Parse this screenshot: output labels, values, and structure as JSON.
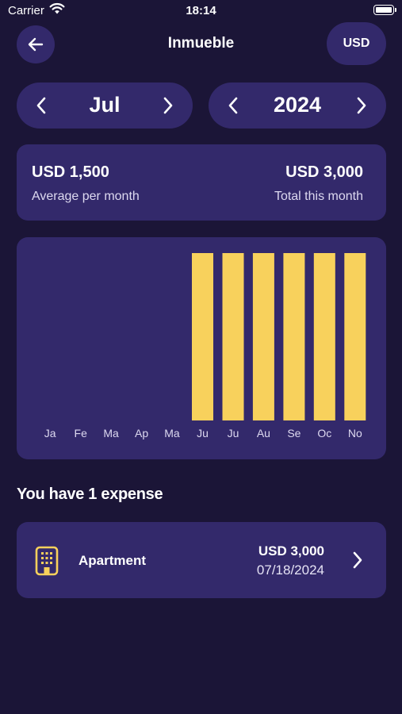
{
  "status_bar": {
    "carrier": "Carrier",
    "time": "18:14"
  },
  "header": {
    "title": "Inmueble",
    "currency": "USD"
  },
  "selectors": {
    "month": "Jul",
    "year": "2024"
  },
  "summary": {
    "average_amount": "USD 1,500",
    "average_label": "Average per month",
    "total_amount": "USD 3,000",
    "total_label": "Total this month"
  },
  "chart_data": {
    "type": "bar",
    "categories": [
      "Ja",
      "Fe",
      "Ma",
      "Ap",
      "Ma",
      "Ju",
      "Ju",
      "Au",
      "Se",
      "Oc",
      "No"
    ],
    "values": [
      0,
      0,
      0,
      0,
      0,
      3000,
      3000,
      3000,
      3000,
      3000,
      3000
    ],
    "ylim": [
      0,
      3000
    ],
    "grid": false,
    "colors": {
      "bar": "#f8d15c"
    }
  },
  "expenses_title": "You have 1 expense",
  "expenses": [
    {
      "name": "Apartment",
      "amount": "USD 3,000",
      "date": "07/18/2024",
      "icon": "building-icon"
    }
  ],
  "colors": {
    "background": "#1b1537",
    "card": "#33296b",
    "accent": "#f8d15c"
  }
}
